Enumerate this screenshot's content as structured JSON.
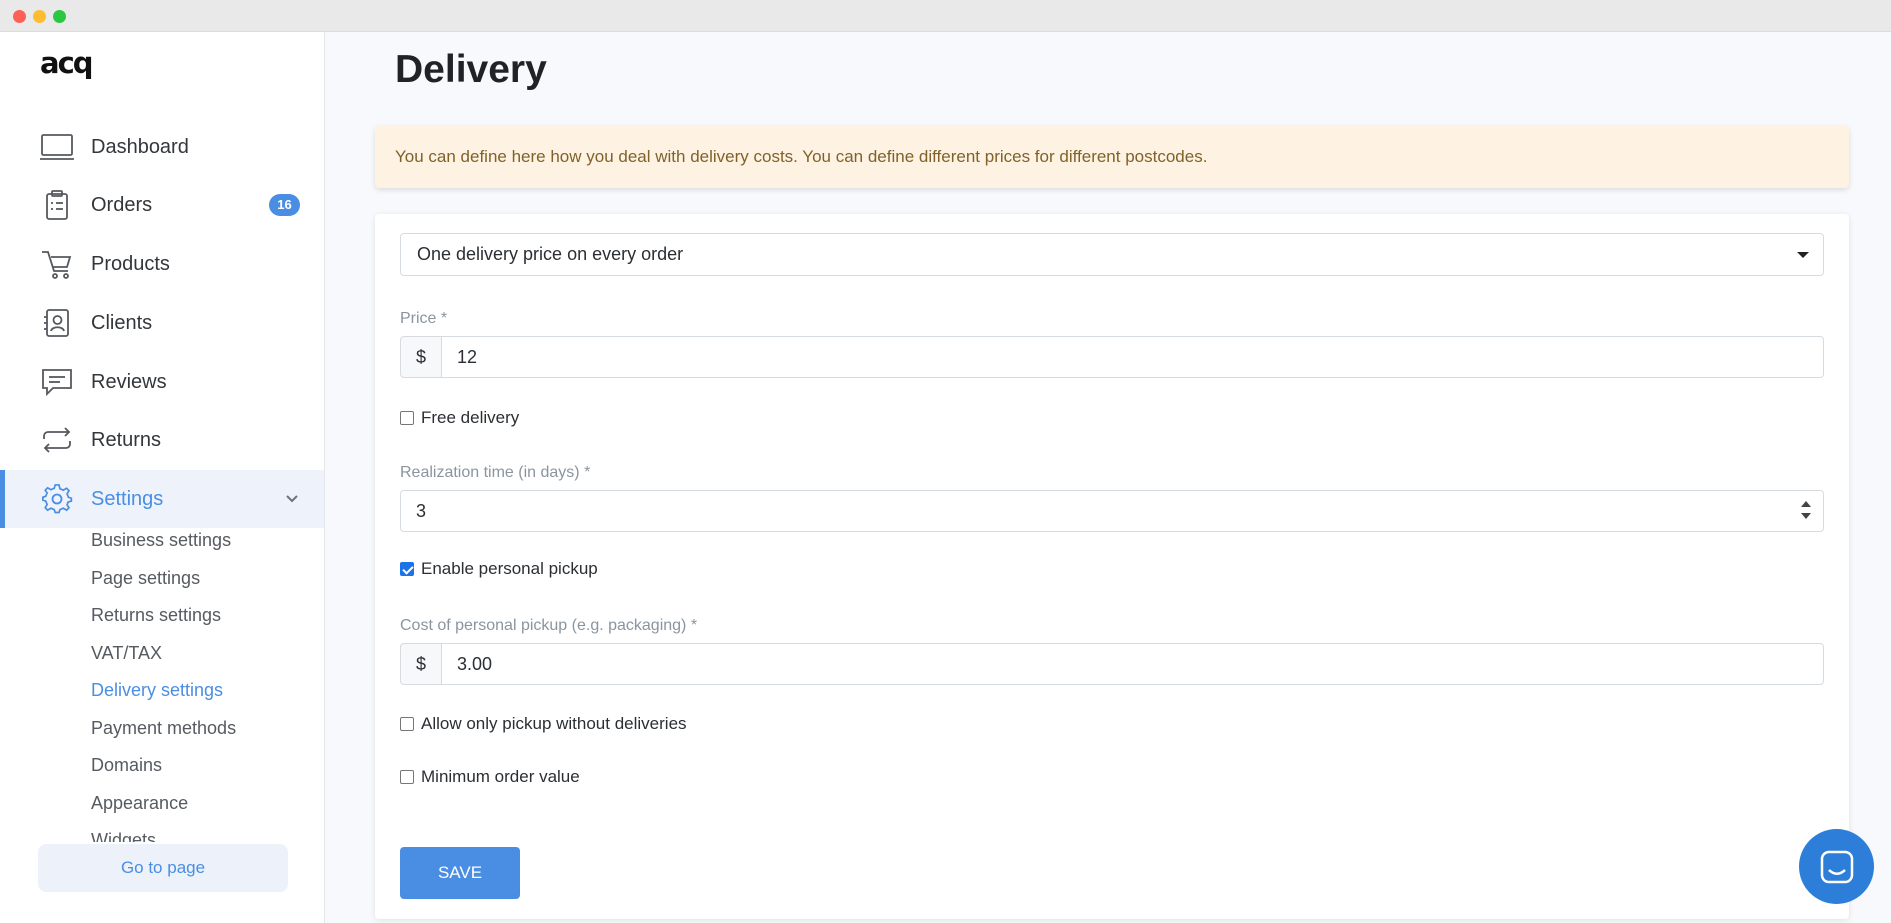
{
  "app": {
    "logo": "acq"
  },
  "sidebar": {
    "items": [
      {
        "label": "Dashboard",
        "icon": "monitor-icon"
      },
      {
        "label": "Orders",
        "icon": "clipboard-icon",
        "badge": "16"
      },
      {
        "label": "Products",
        "icon": "cart-icon"
      },
      {
        "label": "Clients",
        "icon": "contacts-icon"
      },
      {
        "label": "Reviews",
        "icon": "comment-icon"
      },
      {
        "label": "Returns",
        "icon": "returns-icon"
      },
      {
        "label": "Settings",
        "icon": "gear-icon"
      }
    ],
    "settings_sub": [
      "Business settings",
      "Page settings",
      "Returns settings",
      "VAT/TAX",
      "Delivery settings",
      "Payment methods",
      "Domains",
      "Appearance",
      "Widgets"
    ],
    "go_to_page": "Go to page"
  },
  "main": {
    "title": "Delivery",
    "notice": "You can define here how you deal with delivery costs. You can define different prices for different postcodes.",
    "delivery_mode": "One delivery price on every order",
    "price_label": "Price *",
    "currency": "$",
    "price_value": "12",
    "free_delivery_label": "Free delivery",
    "realization_label": "Realization time (in days) *",
    "realization_value": "3",
    "personal_pickup_label": "Enable personal pickup",
    "pickup_cost_label": "Cost of personal pickup (e.g. packaging) *",
    "pickup_cost_value": "3.00",
    "pickup_only_label": "Allow only pickup without deliveries",
    "min_order_label": "Minimum order value",
    "save_label": "SAVE"
  },
  "colors": {
    "accent": "#4a8ee3",
    "notice_bg": "#fef3e2",
    "notice_text": "#80612b"
  }
}
